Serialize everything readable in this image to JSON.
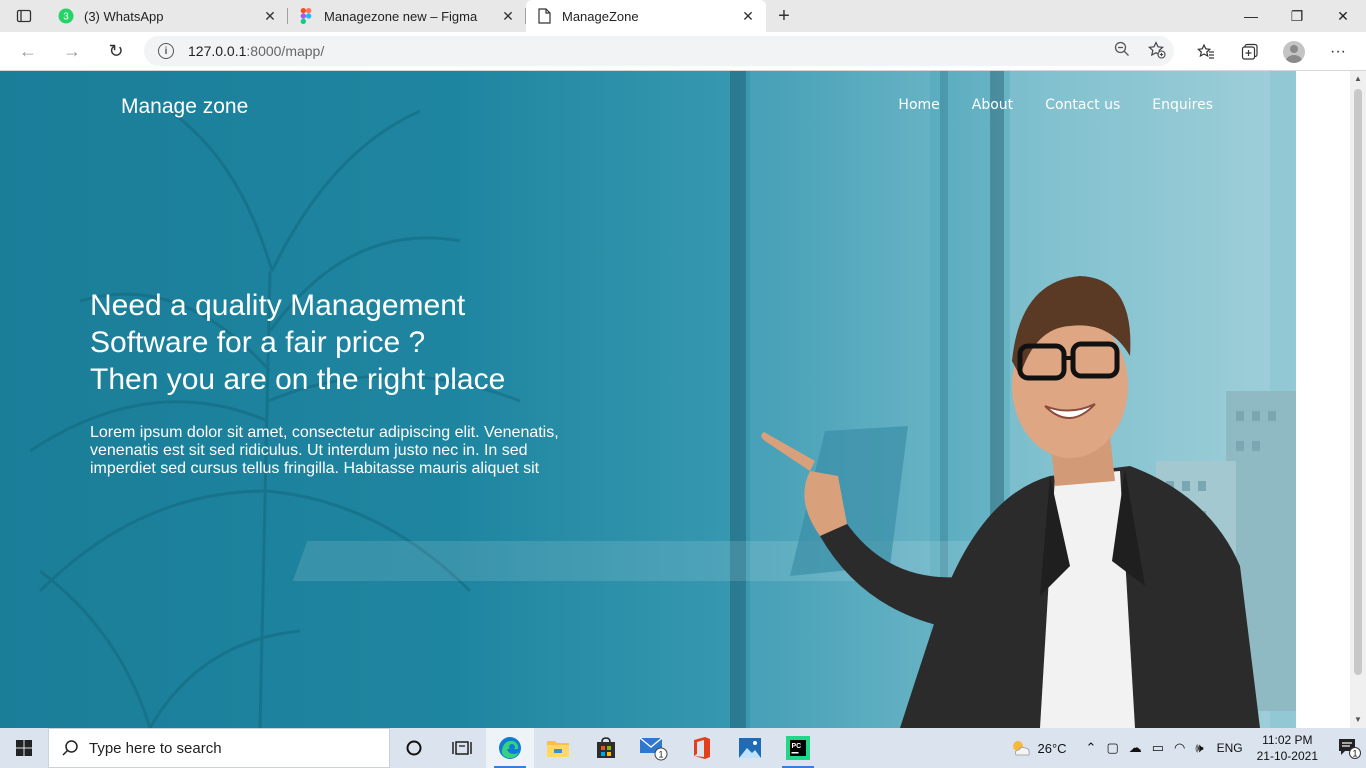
{
  "browser": {
    "tabs": [
      {
        "title": "(3) WhatsApp",
        "badge": "3",
        "icon": "whatsapp-icon",
        "active": false
      },
      {
        "title": "Managezone new – Figma",
        "icon": "figma-icon",
        "active": false
      },
      {
        "title": "ManageZone",
        "icon": "page-icon",
        "active": true
      }
    ],
    "url_host": "127.0.0.1",
    "url_path": ":8000/mapp/"
  },
  "site": {
    "brand": "Manage zone",
    "nav": [
      "Home",
      "About",
      "Contact us",
      "Enquires"
    ],
    "headline": [
      "Need a quality Management",
      "Software for a fair price ?",
      "Then you are on the right place"
    ],
    "body": "Lorem ipsum dolor sit amet, consectetur adipiscing elit. Venenatis, venenatis est sit sed ridiculus. Ut interdum justo nec in. In sed imperdiet sed cursus tellus fringilla. Habitasse mauris aliquet sit"
  },
  "taskbar": {
    "search_placeholder": "Type here to search",
    "weather_temp": "26°C",
    "language": "ENG",
    "time": "11:02 PM",
    "date": "21-10-2021",
    "mail_badge": "1",
    "notification_badge": "1"
  }
}
